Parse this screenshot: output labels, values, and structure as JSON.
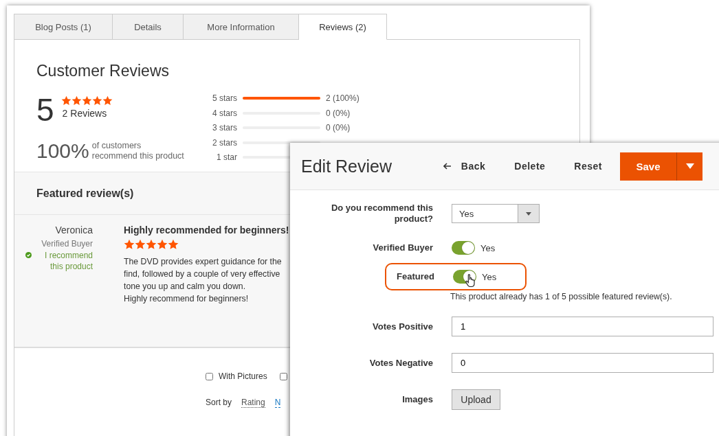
{
  "tabs": [
    {
      "label": "Blog Posts (1)",
      "selected": false
    },
    {
      "label": "Details",
      "selected": false
    },
    {
      "label": "More Information",
      "selected": false
    },
    {
      "label": "Reviews (2)",
      "selected": true
    }
  ],
  "reviews_summary": {
    "heading": "Customer Reviews",
    "average": "5",
    "stars": 5,
    "review_count": "2 Reviews",
    "recommend_percent": "100%",
    "recommend_text": "of customers recommend this product"
  },
  "histogram": [
    {
      "label": "5 stars",
      "level": 1,
      "count": "2 (100%)"
    },
    {
      "label": "4 stars",
      "level": 0,
      "count": "0 (0%)"
    },
    {
      "label": "3 stars",
      "level": 0,
      "count": "0 (0%)"
    },
    {
      "label": "2 stars",
      "level": 0
    },
    {
      "label": "1 star",
      "level": 0
    }
  ],
  "featured": {
    "heading": "Featured review(s)",
    "review": {
      "author": "Veronica",
      "badge": "Verified Buyer",
      "recommend": "I recommend this product",
      "title": "Highly recommended for beginners!",
      "stars": 5,
      "body_lines": [
        "The DVD provides expert guidance for the",
        "find, followed by a couple of very effective",
        "tone you up and calm you down.",
        "Highly recommend for beginners!"
      ]
    }
  },
  "filters": [
    {
      "label": "With Pictures",
      "checked": false
    },
    {
      "checked": false
    }
  ],
  "sort": {
    "label": "Sort by",
    "options": [
      {
        "label": "Rating",
        "selected": true
      },
      {
        "label": "N",
        "selected": false
      }
    ]
  },
  "edit_panel": {
    "title": "Edit Review",
    "actions": [
      {
        "label": "Back",
        "kind": "back"
      },
      {
        "label": "Delete",
        "kind": "plain"
      },
      {
        "label": "Reset",
        "kind": "plain"
      }
    ],
    "save": "Save",
    "fields": [
      {
        "kind": "select",
        "label": "Do you recommend this product?",
        "value": "Yes"
      },
      {
        "kind": "toggle",
        "label": "Verified Buyer",
        "on": true,
        "value": "Yes"
      },
      {
        "kind": "toggle",
        "label": "Featured",
        "on": true,
        "value": "Yes",
        "highlighted": true,
        "note": "This product already has 1 of 5 possible featured review(s)."
      },
      {
        "kind": "text",
        "label": "Votes Positive",
        "value": "1"
      },
      {
        "kind": "text",
        "label": "Votes Negative",
        "value": "0"
      },
      {
        "kind": "upload",
        "label": "Images",
        "button": "Upload"
      }
    ]
  }
}
